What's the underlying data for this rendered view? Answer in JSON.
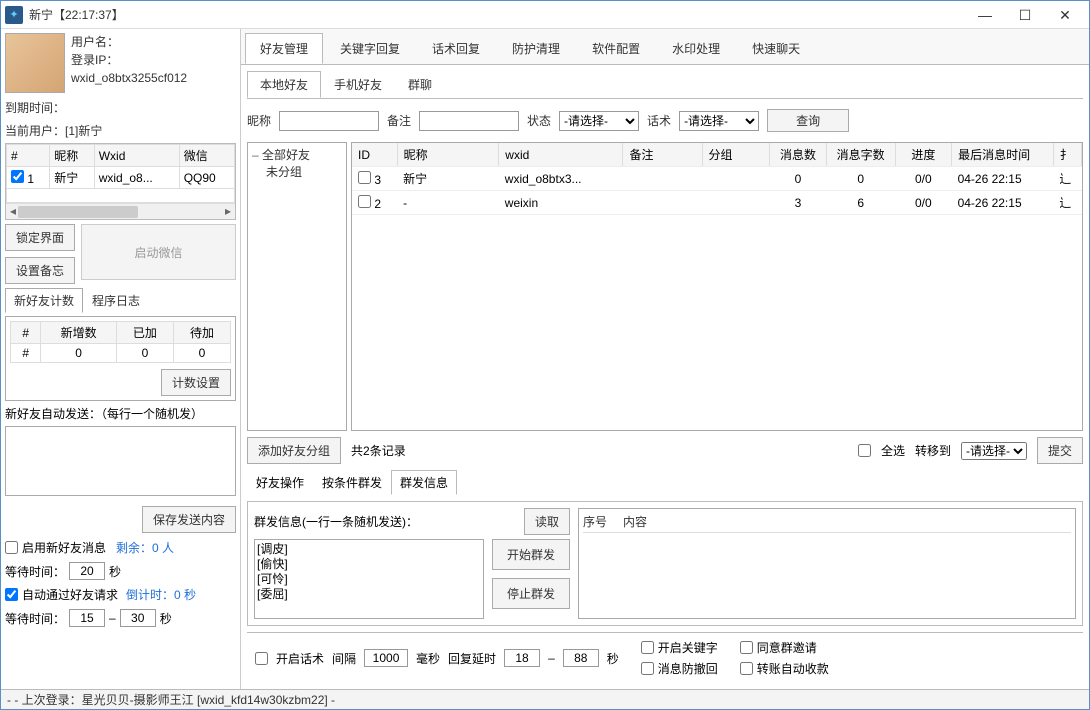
{
  "title": "新宁【22:17:37】",
  "user": {
    "label_username": "用户名：",
    "label_login_ip": "登录IP：",
    "wxid": "wxid_o8btx3255cf012",
    "expire_label": "到期时间：",
    "current_user_label": "当前用户：[1]新宁"
  },
  "left_grid": {
    "headers": [
      "#",
      "昵称",
      "Wxid",
      "微信"
    ],
    "row": {
      "idx": "1",
      "nick": "新宁",
      "wxid": "wxid_o8...",
      "wx": "QQ90"
    }
  },
  "buttons": {
    "lock": "锁定界面",
    "memo": "设置备忘",
    "launch": "启动微信",
    "count_settings": "计数设置",
    "save_send": "保存发送内容",
    "add_group": "添加好友分组",
    "query": "查询",
    "submit": "提交",
    "read": "读取",
    "start_send": "开始群发",
    "stop_send": "停止群发"
  },
  "left_tabs": {
    "count": "新好友计数",
    "log": "程序日志"
  },
  "count_table": {
    "headers": [
      "#",
      "新增数",
      "已加",
      "待加"
    ],
    "values": [
      "#",
      "0",
      "0",
      "0"
    ]
  },
  "auto_send_label": "新好友自动发送：（每行一个随机发）",
  "enable_new_msg": "启用新好友消息",
  "remaining": "剩余：0 人",
  "wait_label": "等待时间：",
  "wait1": "20",
  "sec": "秒",
  "auto_accept": "自动通过好友请求",
  "countdown": "倒计时：0 秒",
  "wait2a": "15",
  "wait2b": "30",
  "main_tabs": [
    "好友管理",
    "关键字回复",
    "话术回复",
    "防护清理",
    "软件配置",
    "水印处理",
    "快速聊天"
  ],
  "inner_tabs": [
    "本地好友",
    "手机好友",
    "群聊"
  ],
  "search": {
    "nick": "昵称",
    "remark": "备注",
    "state": "状态",
    "script": "话术",
    "select_placeholder": "-请选择-"
  },
  "tree": {
    "all": "全部好友",
    "ungrouped": "未分组"
  },
  "grid_headers": [
    "ID",
    "昵称",
    "wxid",
    "备注",
    "分组",
    "消息数",
    "消息字数",
    "进度",
    "最后消息时间",
    "扌"
  ],
  "grid_rows": [
    {
      "chk": false,
      "id": "3",
      "nick": "新宁",
      "wxid": "wxid_o8btx3...",
      "remark": "",
      "group": "",
      "msgs": "0",
      "chars": "0",
      "prog": "0/0",
      "last": "04-26 22:15",
      "t": "辶"
    },
    {
      "chk": false,
      "id": "2",
      "nick": "-",
      "wxid": "weixin",
      "remark": "",
      "group": "",
      "msgs": "3",
      "chars": "6",
      "prog": "0/0",
      "last": "04-26 22:15",
      "t": "辶"
    }
  ],
  "record_count": "共2条记录",
  "select_all": "全选",
  "move_to": "转移到",
  "op_tabs": [
    "好友操作",
    "按条件群发",
    "群发信息"
  ],
  "group_send_label": "群发信息(一行一条随机发送)：",
  "msg_lines": [
    "[调皮]",
    "[偷快]",
    "[可怜]",
    "[委屈]"
  ],
  "right_table": {
    "seq": "序号",
    "content": "内容"
  },
  "bottom": {
    "enable_script": "开启话术",
    "interval_label": "间隔",
    "interval": "1000",
    "ms": "毫秒",
    "reply_delay_label": "回复延时",
    "delay_a": "18",
    "delay_b": "88",
    "enable_keyword": "开启关键字",
    "accept_group_invite": "同意群邀请",
    "anti_recall": "消息防撤回",
    "auto_collect": "转账自动收款"
  },
  "status": "-  -  上次登录：星光贝贝-摄影师王江 [wxid_kfd14w30kzbm22]  -"
}
